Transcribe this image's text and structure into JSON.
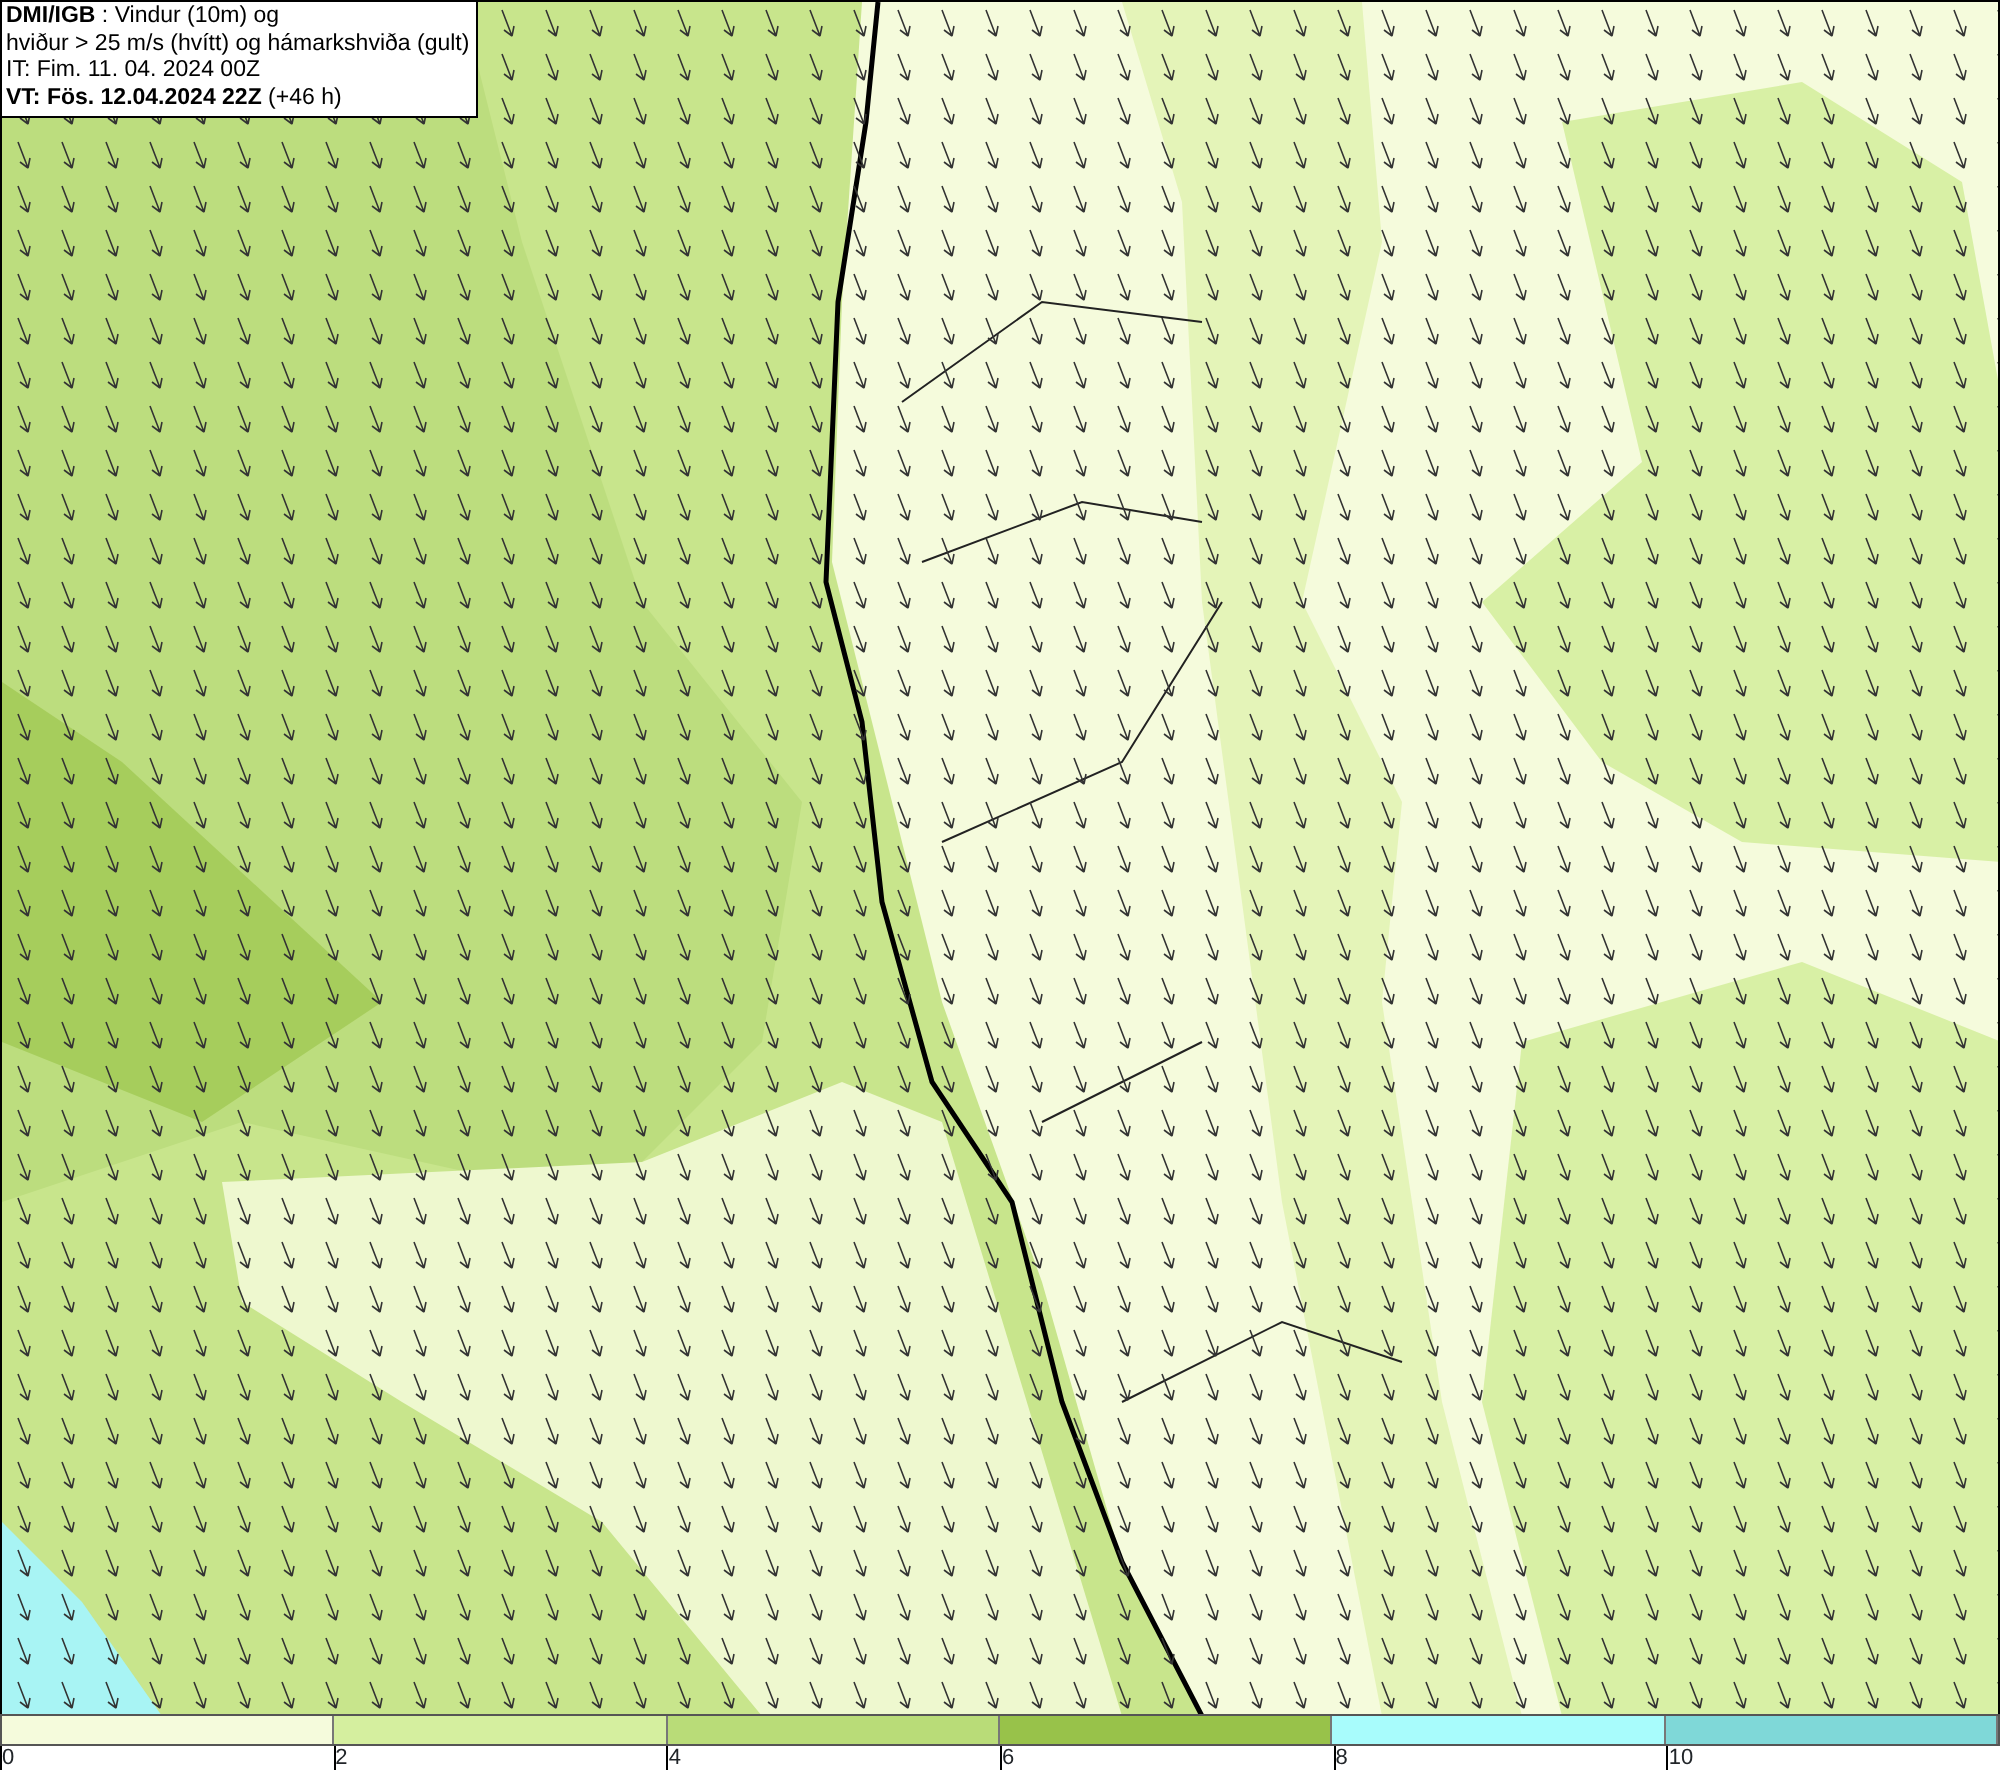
{
  "title_box": {
    "lines": [
      "**DMI/IGB** : Vindur (10m) og",
      "hviður > 25 m/s (hvítt) og hámarkshviða (gult)",
      "IT: Fim. 11. 04. 2024 00Z",
      "**VT: Fös. 12.04.2024 22Z** (+46 h)"
    ]
  },
  "legend": {
    "segments": [
      {
        "color": "#f5fbdc"
      },
      {
        "color": "#d5ef9f"
      },
      {
        "color": "#b9dc78"
      },
      {
        "color": "#98c24a"
      },
      {
        "color": "#a8fcfc"
      },
      {
        "color": "#7fd8d8"
      }
    ],
    "ticks": [
      "0",
      "2",
      "4",
      "6",
      "8",
      "10"
    ]
  }
}
